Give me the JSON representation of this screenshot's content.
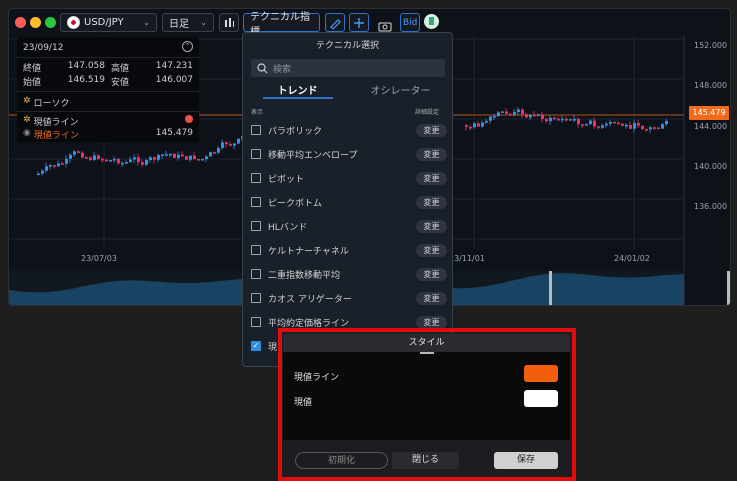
{
  "toolbar": {
    "pair": "USD/JPY",
    "timeframe": "日足",
    "indicator_label": "テクニカル指標",
    "bid_label": "Bid",
    "icons": [
      "candle-settings-icon",
      "pen-icon",
      "add-icon",
      "camera-icon",
      "share-icon"
    ]
  },
  "info_panel": {
    "date": "23/09/12",
    "rows": [
      {
        "label1": "終値",
        "value1": "147.058",
        "label2": "高値",
        "value2": "147.231"
      },
      {
        "label1": "始値",
        "value1": "146.519",
        "label2": "安値",
        "value2": "146.007"
      }
    ],
    "candle_label": "ローソク",
    "current_line_title": "現値ライン",
    "current_line_sub": "現値ライン",
    "current_value": "145.479"
  },
  "price_axis": {
    "labels": [
      "152.000",
      "148.000",
      "144.000",
      "140.000",
      "136.000"
    ],
    "current_price": "145.479"
  },
  "date_axis": {
    "labels": [
      "23/07/03",
      "23/11/01",
      "24/01/02"
    ]
  },
  "technical_modal": {
    "title": "テクニカル選択",
    "search_placeholder": "検索",
    "tab_trend": "トレンド",
    "tab_oscillator": "オシレーター",
    "col_display": "表示",
    "col_settings": "詳細設定",
    "change_label": "変更",
    "items": [
      {
        "label": "パラボリック",
        "checked": false
      },
      {
        "label": "移動平均エンベロープ",
        "checked": false
      },
      {
        "label": "ピボット",
        "checked": false
      },
      {
        "label": "ピークボトム",
        "checked": false
      },
      {
        "label": "HLバンド",
        "checked": false
      },
      {
        "label": "ケルトナーチャネル",
        "checked": false
      },
      {
        "label": "二重指数移動平均",
        "checked": false
      },
      {
        "label": "カオス アリゲーター",
        "checked": false
      },
      {
        "label": "平均約定価格ライン",
        "checked": false
      },
      {
        "label": "現",
        "checked": true
      }
    ]
  },
  "style_modal": {
    "title": "スタイル",
    "row1_label": "現値ライン",
    "row1_color": "#f25f0c",
    "row2_label": "現値",
    "row2_color": "#ffffff",
    "reset_label": "初期化",
    "close_label": "閉じる",
    "save_label": "保存"
  },
  "colors": {
    "up": "#3a8ee6",
    "down": "#e8336b",
    "accent": "#2f74c9",
    "price_line": "#f26b1d",
    "highlight": "#e10d0d"
  }
}
